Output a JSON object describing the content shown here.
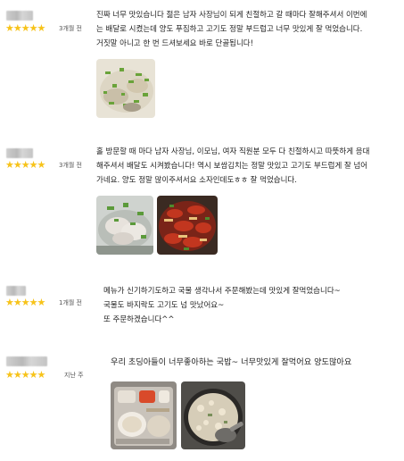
{
  "reviews": [
    {
      "stars": "★★★★★",
      "date": "3개월 전",
      "text": "진짜 너무 맛있습니다 젊은 남자 사장님이 되게 친절하고 갈 때마다 잘해주셔서 이번에\n는 배달로 시켰는데 양도 푸짐하고 고기도 정말 부드럽고 너무 맛있게 잘 먹었습니다.\n거짓말 아니고 한 번 드셔보세요 바로 단골됩니다!"
    },
    {
      "stars": "★★★★★",
      "date": "3개월 전",
      "text": "홀 방문할 때 마다 남자 사장님, 이모님, 여자 직원분 모두 다 친절하시고 따뜻하게 응대\n해주셔서 배달도 시켜봤습니다! 역시 보쌈김치는 정말 맛있고 고기도 부드럽게 잘 넘어\n가네요. 양도 정말 많이주셔서요 소자인데도ㅎㅎ 잘 먹었습니다."
    },
    {
      "stars": "★★★★★",
      "date": "1개월 전",
      "text": "메뉴가 신기하기도하고 국물 생각나서 주문해봤는데 맛있게 잘먹었습니다~\n국물도 바지락도 고기도 넘 맛났어요~\n또 주문하겠습니다^^"
    },
    {
      "stars": "★★★★★",
      "date": "지난 주",
      "text": "우리 초딩아들이 너무좋아하는 국밥~ 너무맛있게 잘먹어요 양도많아요"
    }
  ],
  "colors": {
    "star": "#f7c31a",
    "text": "#222222",
    "date": "#555555"
  }
}
